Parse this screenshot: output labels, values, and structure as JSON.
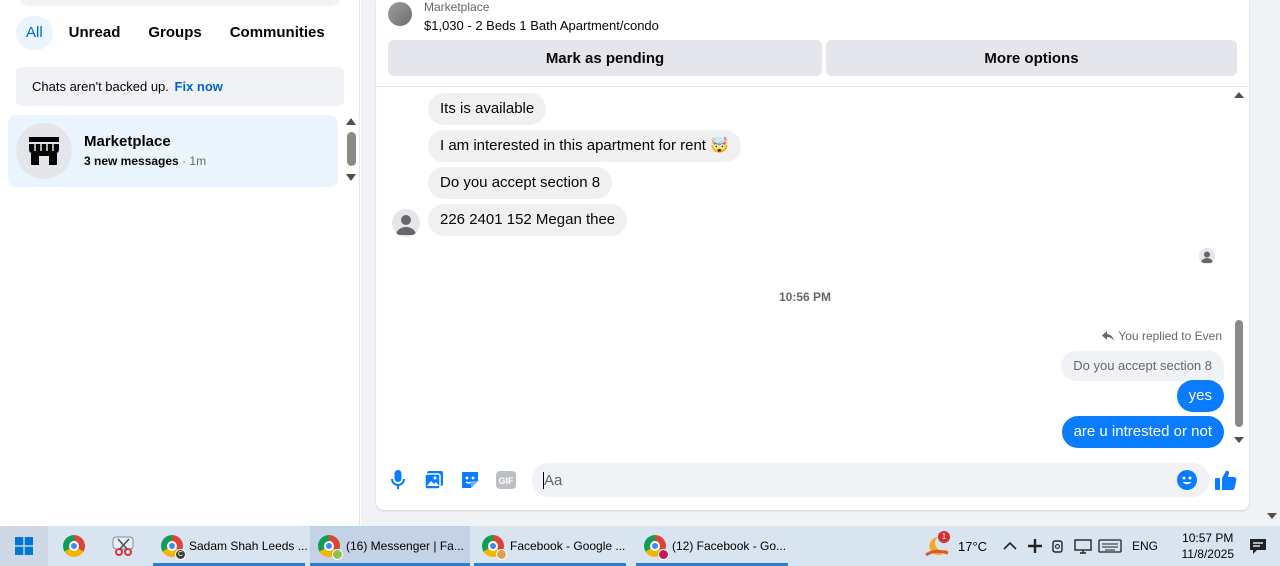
{
  "sidebar": {
    "tabs": [
      {
        "label": "All",
        "active": true
      },
      {
        "label": "Unread"
      },
      {
        "label": "Groups"
      },
      {
        "label": "Communities"
      }
    ],
    "backup_banner": {
      "text": "Chats aren't backed up.",
      "link": "Fix now"
    },
    "chat": {
      "name": "Marketplace",
      "unread": "3 new messages",
      "time": " · 1m",
      "icon": "store-icon"
    }
  },
  "listing": {
    "source": "Marketplace",
    "title": "$1,030 - 2 Beds 1 Bath Apartment/condo",
    "actions": {
      "pending": "Mark as pending",
      "more": "More options"
    }
  },
  "messages": {
    "incoming": [
      "Its is available",
      "I am interested in this apartment for rent 🤯",
      "Do you accept section 8",
      "226 2401 152 Megan thee"
    ],
    "timestamp": "10:56 PM",
    "reply_note": "You replied to Even",
    "reply_quote": "Do you accept section 8",
    "outgoing": [
      "yes",
      "are u intrested or not"
    ]
  },
  "composer": {
    "placeholder": "Aa",
    "icons": [
      "microphone-icon",
      "photo-icon",
      "sticker-icon",
      "gif-icon",
      "emoji-icon",
      "like-icon"
    ],
    "gif_label": "GIF"
  },
  "colors": {
    "accent": "#0a7cff",
    "link": "#0064d1",
    "bubble_in": "#f0f0f0",
    "panel_bg": "#f0f2f5"
  },
  "taskbar": {
    "apps": [
      {
        "label": "Sadam Shah Leeds ...",
        "badge": "C"
      },
      {
        "label": "(16) Messenger | Fa..."
      },
      {
        "label": "Facebook - Google ..."
      },
      {
        "label": "(12) Facebook - Go..."
      }
    ],
    "weather": {
      "temp": "17°C",
      "badge": "1"
    },
    "language": "ENG",
    "time": "10:57 PM",
    "date": "11/8/2025"
  }
}
